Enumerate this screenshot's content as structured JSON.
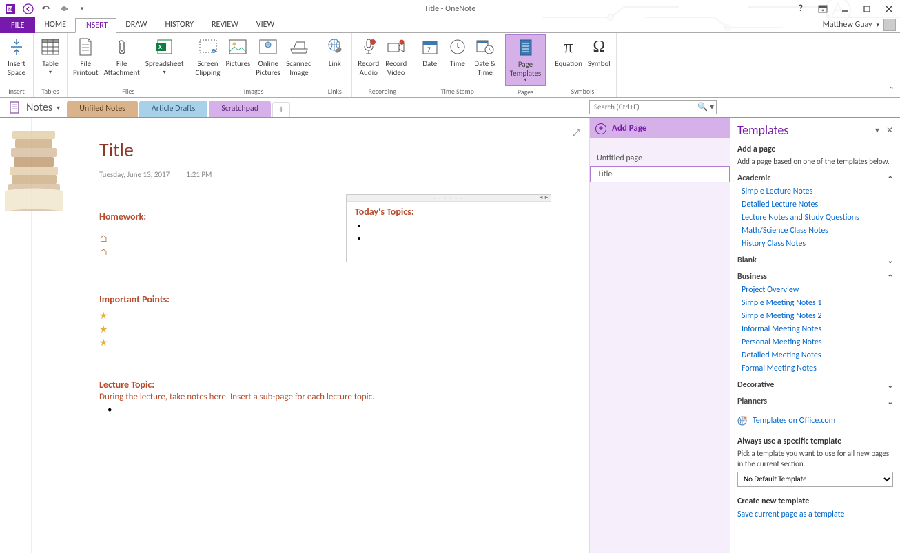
{
  "window": {
    "title": "Title - OneNote",
    "user": "Matthew Guay"
  },
  "ribbon_tabs": {
    "file": "FILE",
    "home": "HOME",
    "insert": "INSERT",
    "draw": "DRAW",
    "history": "HISTORY",
    "review": "REVIEW",
    "view": "VIEW"
  },
  "ribbon": {
    "groups": {
      "insert": "Insert",
      "tables": "Tables",
      "files": "Files",
      "images": "Images",
      "links": "Links",
      "recording": "Recording",
      "timestamp": "Time Stamp",
      "pages": "Pages",
      "symbols": "Symbols"
    },
    "buttons": {
      "insert_space": "Insert\nSpace",
      "table": "Table",
      "file_printout": "File\nPrintout",
      "file_attachment": "File\nAttachment",
      "spreadsheet": "Spreadsheet",
      "screen_clipping": "Screen\nClipping",
      "pictures": "Pictures",
      "online_pictures": "Online\nPictures",
      "scanned_image": "Scanned\nImage",
      "link": "Link",
      "record_audio": "Record\nAudio",
      "record_video": "Record\nVideo",
      "date": "Date",
      "time": "Time",
      "date_time": "Date &\nTime",
      "page_templates": "Page\nTemplates",
      "equation": "Equation",
      "symbol": "Symbol"
    }
  },
  "notebook": {
    "label": "Notes"
  },
  "sections": {
    "unfiled": "Unfiled Notes",
    "drafts": "Article Drafts",
    "scratch": "Scratchpad"
  },
  "search": {
    "placeholder": "Search (Ctrl+E)"
  },
  "page": {
    "title": "Title",
    "date": "Tuesday, June 13, 2017",
    "time": "1:21 PM",
    "homework": "Homework:",
    "important": "Important Points:",
    "lecture_topic": "Lecture Topic:",
    "lecture_text": "During the lecture, take notes here.  Insert a sub-page for each lecture topic.",
    "todays_topics": "Today's Topics:"
  },
  "pagelist": {
    "add": "Add Page",
    "untitled": "Untitled page",
    "title_page": "Title"
  },
  "templates": {
    "title": "Templates",
    "add_page": "Add a page",
    "add_desc": "Add a page based on one of the templates below.",
    "cat_academic": "Academic",
    "academic": {
      "a1": "Simple Lecture Notes",
      "a2": "Detailed Lecture Notes",
      "a3": "Lecture Notes and Study Questions",
      "a4": "Math/Science Class Notes",
      "a5": "History Class Notes"
    },
    "cat_blank": "Blank",
    "cat_business": "Business",
    "business": {
      "b1": "Project Overview",
      "b2": "Simple Meeting Notes 1",
      "b3": "Simple Meeting Notes 2",
      "b4": "Informal Meeting Notes",
      "b5": "Personal Meeting Notes",
      "b6": "Detailed Meeting Notes",
      "b7": "Formal Meeting Notes"
    },
    "cat_decorative": "Decorative",
    "cat_planners": "Planners",
    "office_link": "Templates on Office.com",
    "always_title": "Always use a specific template",
    "always_desc": "Pick a template you want to use for all new pages in the current section.",
    "default_select": "No Default Template",
    "create_title": "Create new template",
    "save_link": "Save current page as a template"
  }
}
